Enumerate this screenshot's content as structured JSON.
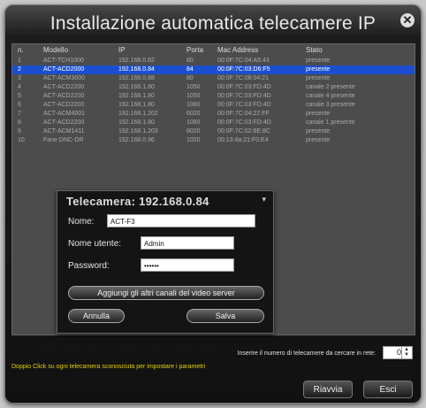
{
  "window": {
    "title": "Installazione automatica telecamere IP"
  },
  "table": {
    "headers": {
      "n": "n.",
      "model": "Modello",
      "ip": "IP",
      "port": "Porta",
      "mac": "Mac Address",
      "status": "Stato"
    },
    "rows": [
      {
        "n": "1",
        "model": "ACT-TCH1000",
        "ip": "192.168.0.82",
        "port": "80",
        "mac": "00:0F:7C:04:A5:43",
        "status": "presente"
      },
      {
        "n": "2",
        "model": "ACT-ACD2000",
        "ip": "192.168.0.84",
        "port": "84",
        "mac": "00:0F:7C:03:D6:F5",
        "status": "presente",
        "selected": true
      },
      {
        "n": "3",
        "model": "ACT-ACM3000",
        "ip": "192.168.0.88",
        "port": "80",
        "mac": "00:0F:7C:08:04:21",
        "status": "presente"
      },
      {
        "n": "4",
        "model": "ACT-ACD2200",
        "ip": "192.168.1.80",
        "port": "1050",
        "mac": "00:0F:7C:03:FD:4D",
        "status": "canale 2 presente"
      },
      {
        "n": "5",
        "model": "ACT-ACD2200",
        "ip": "192.168.1.80",
        "port": "1050",
        "mac": "00:0F:7C:03:FD:4D",
        "status": "canale 4 presente"
      },
      {
        "n": "6",
        "model": "ACT-ACD2200",
        "ip": "192.168.1.80",
        "port": "1080",
        "mac": "00:0F:7C:03:FD:4D",
        "status": "canale 3 presente"
      },
      {
        "n": "7",
        "model": "ACT-ACM4001",
        "ip": "192.168.1.202",
        "port": "6020",
        "mac": "00:0F:7C:04:22:FF",
        "status": "presente"
      },
      {
        "n": "8",
        "model": "ACT-ACD2200",
        "ip": "192.168.1.80",
        "port": "1080",
        "mac": "00:0F:7C:03:FD:4D",
        "status": "canale 1 presente"
      },
      {
        "n": "9",
        "model": "ACT-ACM1411",
        "ip": "192.168.1.203",
        "port": "8020",
        "mac": "00:0F:7C:02:8E:8C",
        "status": "presente"
      },
      {
        "n": "10",
        "model": "Fane DNC-DR",
        "ip": "192.168.0.96",
        "port": "1020",
        "mac": "00:13:4a:21:F0:E4",
        "status": "presente"
      }
    ]
  },
  "dialog": {
    "title": "Telecamera: 192.168.0.84",
    "name_label": "Nome:",
    "name_value": "ACT-F3",
    "user_label": "Nome utente:",
    "user_value": "Admin",
    "password_label": "Password:",
    "password_value": "••••••",
    "add_channels_label": "Aggiungi gli altri canali del video server",
    "cancel_label": "Annulla",
    "save_label": "Salva"
  },
  "footer": {
    "count_label": "Inserire il numero di telecamere da cercare in rete:",
    "count_value": "0",
    "hint": "Doppio Click su ogni telecamera sconosciuta per impostare i parametri",
    "restart_label": "Riavvia",
    "exit_label": "Esci"
  },
  "colors": {
    "selection": "#1c4fcf",
    "hint": "#e8d000"
  }
}
